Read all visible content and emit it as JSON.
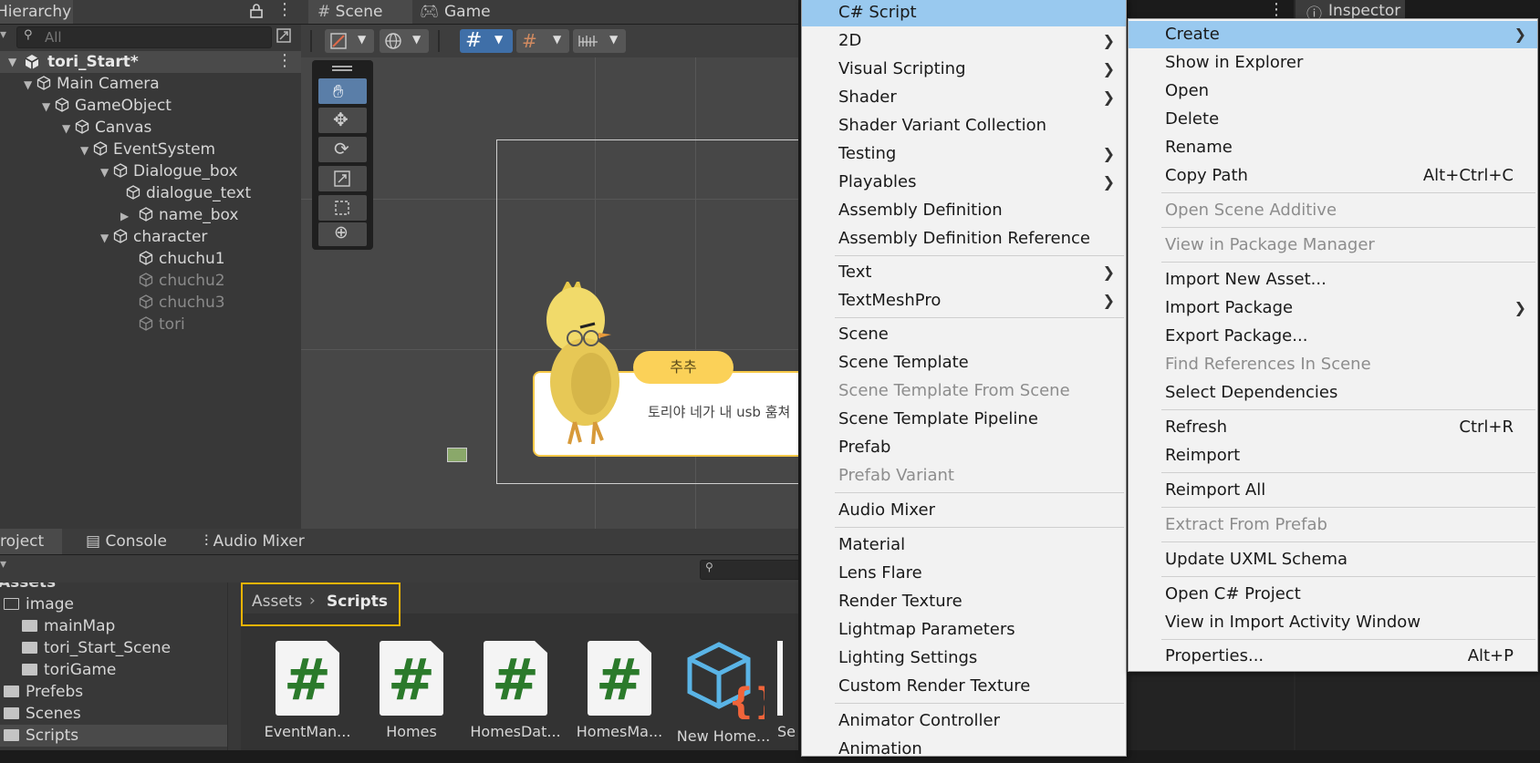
{
  "hierarchy": {
    "tab_label": "Hierarchy",
    "search_placeholder": "All",
    "scene_name": "tori_Start*",
    "items": [
      {
        "label": "Main Camera"
      },
      {
        "label": "GameObject"
      },
      {
        "label": "Canvas"
      },
      {
        "label": "EventSystem"
      },
      {
        "label": "Dialogue_box"
      },
      {
        "label": "dialogue_text"
      },
      {
        "label": "name_box"
      },
      {
        "label": "character"
      },
      {
        "label": "chuchu1"
      },
      {
        "label": "chuchu2"
      },
      {
        "label": "chuchu3"
      },
      {
        "label": "tori"
      }
    ]
  },
  "scene": {
    "tabs": [
      {
        "label": "Scene"
      },
      {
        "label": "Game"
      }
    ],
    "name_tag": "추추",
    "dialogue": "토리야 네가 내 usb 훔쳐"
  },
  "inspector": {
    "tab_label": "Inspector"
  },
  "project": {
    "tabs": [
      {
        "label": "Project"
      },
      {
        "label": "Console"
      },
      {
        "label": "Audio Mixer"
      }
    ],
    "tree_root": "Assets",
    "tree": [
      {
        "label": "image"
      },
      {
        "label": "mainMap"
      },
      {
        "label": "tori_Start_Scene"
      },
      {
        "label": "toriGame"
      },
      {
        "label": "Prefebs"
      },
      {
        "label": "Scenes"
      },
      {
        "label": "Scripts"
      }
    ],
    "breadcrumb": {
      "root": "Assets",
      "current": "Scripts"
    },
    "assets": [
      {
        "label": "EventMan..."
      },
      {
        "label": "Homes"
      },
      {
        "label": "HomesDat..."
      },
      {
        "label": "HomesMa..."
      },
      {
        "label": "New Home..."
      },
      {
        "label": "Se"
      }
    ]
  },
  "create_submenu": {
    "items": [
      {
        "label": "C# Script"
      },
      {
        "label": "2D"
      },
      {
        "label": "Visual Scripting"
      },
      {
        "label": "Shader"
      },
      {
        "label": "Shader Variant Collection"
      },
      {
        "label": "Testing"
      },
      {
        "label": "Playables"
      },
      {
        "label": "Assembly Definition"
      },
      {
        "label": "Assembly Definition Reference"
      },
      {
        "label": "Text"
      },
      {
        "label": "TextMeshPro"
      },
      {
        "label": "Scene"
      },
      {
        "label": "Scene Template"
      },
      {
        "label": "Scene Template From Scene"
      },
      {
        "label": "Scene Template Pipeline"
      },
      {
        "label": "Prefab"
      },
      {
        "label": "Prefab Variant"
      },
      {
        "label": "Audio Mixer"
      },
      {
        "label": "Material"
      },
      {
        "label": "Lens Flare"
      },
      {
        "label": "Render Texture"
      },
      {
        "label": "Lightmap Parameters"
      },
      {
        "label": "Lighting Settings"
      },
      {
        "label": "Custom Render Texture"
      },
      {
        "label": "Animator Controller"
      },
      {
        "label": "Animation"
      }
    ]
  },
  "context_menu": {
    "items": [
      {
        "label": "Create"
      },
      {
        "label": "Show in Explorer"
      },
      {
        "label": "Open"
      },
      {
        "label": "Delete"
      },
      {
        "label": "Rename"
      },
      {
        "label": "Copy Path",
        "shortcut": "Alt+Ctrl+C"
      },
      {
        "label": "Open Scene Additive"
      },
      {
        "label": "View in Package Manager"
      },
      {
        "label": "Import New Asset..."
      },
      {
        "label": "Import Package"
      },
      {
        "label": "Export Package..."
      },
      {
        "label": "Find References In Scene"
      },
      {
        "label": "Select Dependencies"
      },
      {
        "label": "Refresh",
        "shortcut": "Ctrl+R"
      },
      {
        "label": "Reimport"
      },
      {
        "label": "Reimport All"
      },
      {
        "label": "Extract From Prefab"
      },
      {
        "label": "Update UXML Schema"
      },
      {
        "label": "Open C# Project"
      },
      {
        "label": "View in Import Activity Window"
      },
      {
        "label": "Properties...",
        "shortcut": "Alt+P"
      }
    ]
  },
  "colors": {
    "highlight": "#99c9ef",
    "breadcrumb_outline": "#f0b400",
    "menu_bg": "#f2f2f2"
  }
}
